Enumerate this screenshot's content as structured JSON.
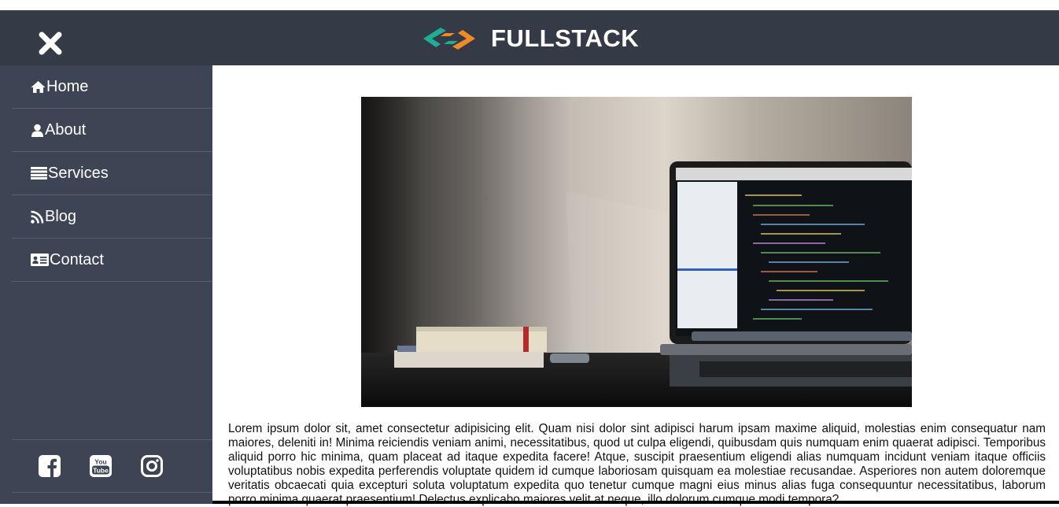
{
  "brand": {
    "title": "FULLSTACK",
    "colors": {
      "header_bg": "#343a46",
      "sidebar_bg": "#3d4454",
      "logo_teal": "#1fae95",
      "logo_orange": "#f08a24"
    }
  },
  "header": {
    "close_icon": "close-icon"
  },
  "sidebar": {
    "items": [
      {
        "label": "Home",
        "icon": "home-icon"
      },
      {
        "label": "About",
        "icon": "user-icon"
      },
      {
        "label": "Services",
        "icon": "list-icon"
      },
      {
        "label": "Blog",
        "icon": "rss-icon"
      },
      {
        "label": "Contact",
        "icon": "contact-card-icon"
      }
    ],
    "social": [
      {
        "icon": "facebook-icon"
      },
      {
        "icon": "youtube-icon"
      },
      {
        "icon": "instagram-icon"
      }
    ]
  },
  "main": {
    "hero_image": "laptop-on-desk-photo",
    "body_text": "Lorem ipsum dolor sit, amet consectetur adipisicing elit. Quam nisi dolor sint adipisci harum ipsam maxime aliquid, molestias enim consequatur nam maiores, deleniti in! Minima reiciendis veniam animi, necessitatibus, quod ut culpa eligendi, quibusdam quis numquam enim quaerat adipisci. Temporibus aliquid porro hic minima, quam placeat ad itaque expedita facere! Atque, suscipit praesentium eligendi alias numquam incidunt veniam itaque officiis voluptatibus nobis expedita perferendis voluptate quidem id cumque laboriosam quisquam ea molestiae recusandae. Asperiores non autem doloremque veritatis obcaecati quia excepturi soluta voluptatum expedita quo tenetur cumque magni eius minus alias fuga consequuntur necessitatibus, laborum porro minima quaerat praesentium! Delectus explicabo maiores velit at neque, illo dolorum cumque modi tempora?"
  }
}
